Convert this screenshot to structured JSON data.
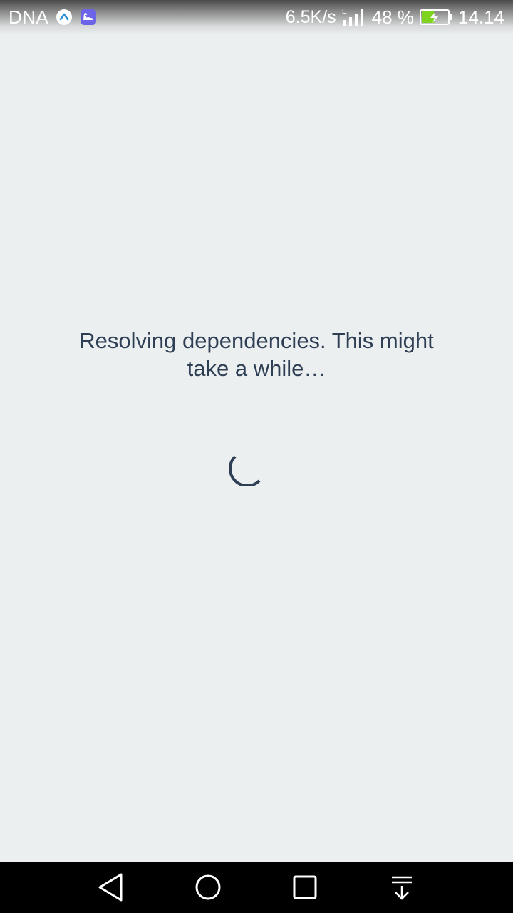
{
  "status_bar": {
    "carrier": "DNA",
    "net_speed": "6.5K/s",
    "network_type": "E",
    "battery_percent": "48 %",
    "battery_level": 0.48,
    "time": "14.14",
    "icons": [
      "app-a-icon",
      "shoe-app-icon",
      "signal-icon",
      "battery-charging-icon"
    ]
  },
  "main": {
    "message": "Resolving dependencies. This might take a while…",
    "accent_color": "#2e3f55",
    "background_color": "#ebeff0"
  },
  "nav_bar": {
    "buttons": [
      "back",
      "home",
      "recents",
      "notifications-pull-down"
    ]
  }
}
